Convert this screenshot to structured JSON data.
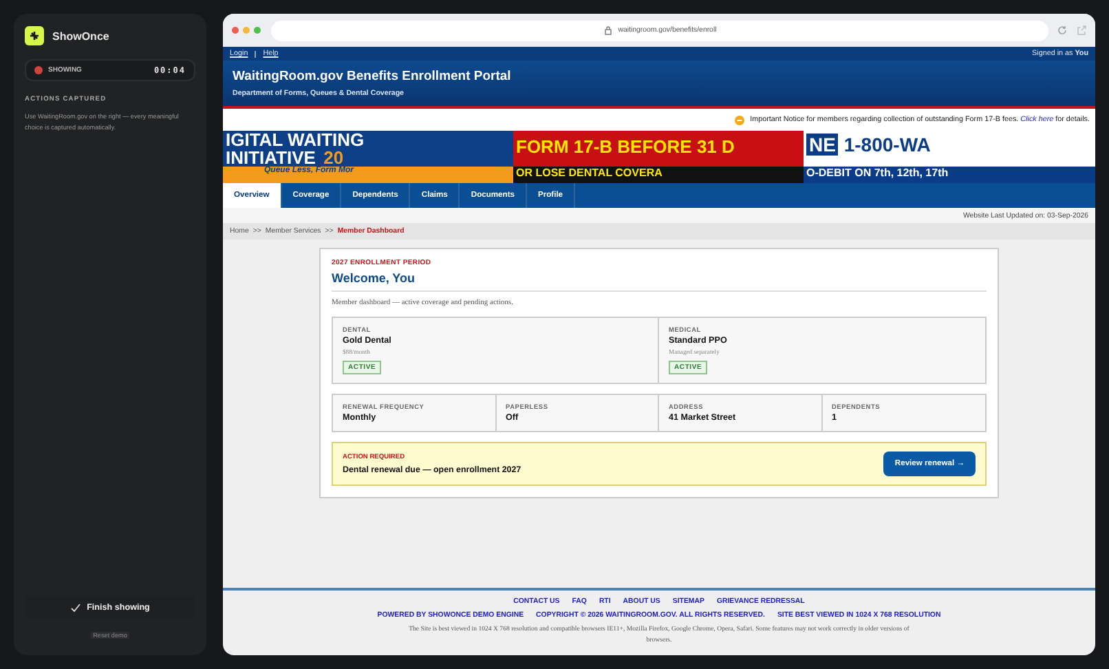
{
  "sidebar": {
    "brand": "ShowOnce",
    "recording": {
      "label": "SHOWING",
      "time": "00:04",
      "on": true
    },
    "section_title": "ACTIONS CAPTURED",
    "hint": "Use WaitingRoom.gov on the right — every meaningful choice is captured automatically.",
    "finish_button": "Finish showing",
    "reset_link": "Reset demo"
  },
  "browser": {
    "url": "waitingroom.gov/benefits/enroll"
  },
  "site": {
    "top_links": [
      "Login",
      "Help"
    ],
    "signed_in_label": "Signed in as",
    "signed_in_user": "You",
    "title": "WaitingRoom.gov Benefits Enrollment Portal",
    "subtitle": "Department of Forms, Queues & Dental Coverage",
    "notice": {
      "text": "Important Notice for members regarding collection of outstanding Form 17-B fees.",
      "link": "Click here",
      "after": "for details."
    },
    "banners": [
      {
        "kind": "initiative",
        "lines": [
          "IGITAL WAITING",
          "INITIATIVE",
          "20",
          "Queue Less, Form Mor"
        ]
      },
      {
        "kind": "form",
        "lines": [
          "FORM 17-B BEFORE 31 D",
          "OR LOSE DENTAL COVERA"
        ]
      },
      {
        "kind": "phone",
        "lines": [
          "NE",
          "1-800-WA",
          "O-DEBIT ON 7th, 12th, 17th"
        ]
      }
    ],
    "tabs": [
      {
        "label": "Overview",
        "selected": true
      },
      {
        "label": "Coverage",
        "selected": false
      },
      {
        "label": "Dependents",
        "selected": false
      },
      {
        "label": "Claims",
        "selected": false
      },
      {
        "label": "Documents",
        "selected": false
      },
      {
        "label": "Profile",
        "selected": false
      }
    ],
    "updated": "Website Last Updated on: 03-Sep-2026",
    "breadcrumb": [
      {
        "label": "Home",
        "current": false
      },
      {
        "label": "Member Services",
        "current": false
      },
      {
        "label": "Member Dashboard",
        "current": true
      }
    ],
    "breadcrumb_separator": ">>",
    "card": {
      "eyebrow": "2027 ENROLLMENT PERIOD",
      "heading": "Welcome, You",
      "intro": "Member dashboard — active coverage and pending actions.",
      "plans": [
        {
          "category": "DENTAL",
          "name": "Gold Dental",
          "detail": "$88/month",
          "status": "ACTIVE"
        },
        {
          "category": "MEDICAL",
          "name": "Standard PPO",
          "detail": "Managed separately",
          "status": "ACTIVE"
        }
      ],
      "facts": [
        {
          "label": "RENEWAL FREQUENCY",
          "value": "Monthly"
        },
        {
          "label": "PAPERLESS",
          "value": "Off"
        },
        {
          "label": "ADDRESS",
          "value": "41 Market Street"
        },
        {
          "label": "DEPENDENTS",
          "value": "1"
        }
      ],
      "action": {
        "label": "ACTION REQUIRED",
        "text": "Dental renewal due — open enrollment 2027",
        "button": "Review renewal →"
      }
    },
    "footer": {
      "links": [
        "CONTACT US",
        "FAQ",
        "RTI",
        "ABOUT US",
        "SITEMAP",
        "GRIEVANCE REDRESSAL"
      ],
      "credits": [
        "POWERED BY SHOWONCE DEMO ENGINE",
        "COPYRIGHT © 2026 WAITINGROOM.GOV. ALL RIGHTS RESERVED.",
        "SITE BEST VIEWED IN 1024 X 768 RESOLUTION"
      ],
      "note": "The Site is best viewed in 1024 X 768 resolution and compatible browsers IE11+, Mozilla Firefox, Google Chrome, Opera, Safari. Some features may not work correctly in older versions of browsers."
    }
  }
}
